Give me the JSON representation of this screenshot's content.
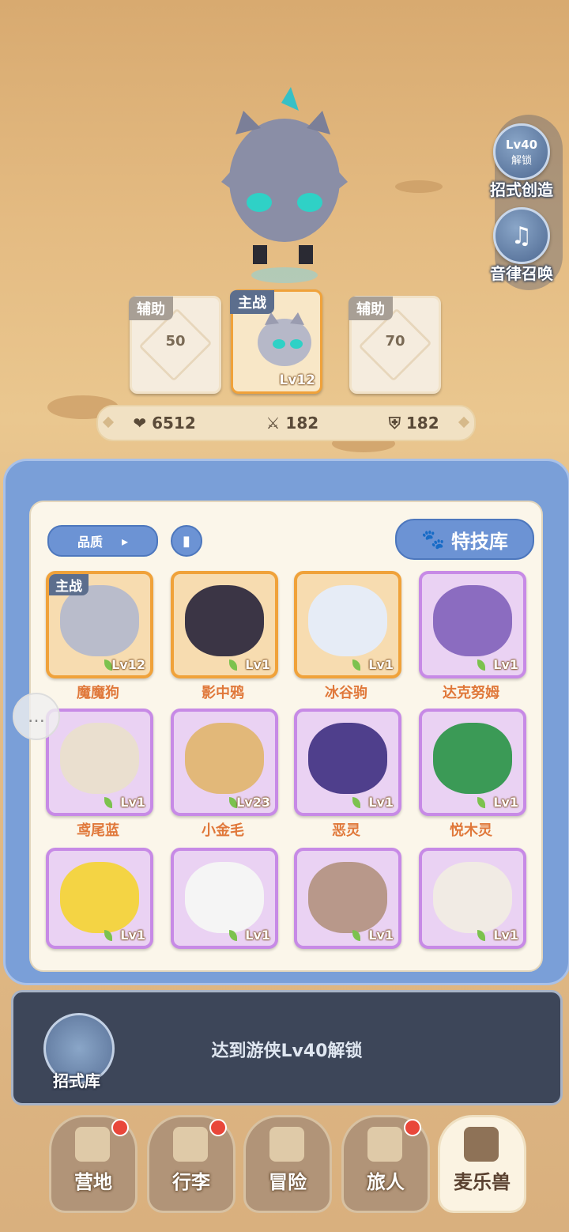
{
  "side_buttons": {
    "skill_create": {
      "badge_top": "Lv40",
      "badge_bottom": "解锁",
      "label": "招式创造"
    },
    "music_summon": {
      "label": "音律召唤"
    }
  },
  "team": {
    "left": {
      "tag": "辅助",
      "value": "50"
    },
    "main": {
      "tag": "主战",
      "level": "Lv12"
    },
    "right": {
      "tag": "辅助",
      "value": "70"
    }
  },
  "stats": {
    "hp": "6512",
    "attack": "182",
    "defense": "182"
  },
  "panel": {
    "filter_label": "品质",
    "skill_library_label": "特技库",
    "pets": [
      {
        "name": "魔魔狗",
        "level": "Lv12",
        "tag": "主战",
        "rarity": "orange",
        "color": "#b9bccb"
      },
      {
        "name": "影中鸦",
        "level": "Lv1",
        "rarity": "orange",
        "color": "#3b3545"
      },
      {
        "name": "冰谷驹",
        "level": "Lv1",
        "rarity": "orange",
        "color": "#e6ecf6"
      },
      {
        "name": "达克努姆",
        "level": "Lv1",
        "rarity": "purple",
        "color": "#8b6cc0"
      },
      {
        "name": "鸢尾蓝",
        "level": "Lv1",
        "rarity": "purple",
        "color": "#eadfcf"
      },
      {
        "name": "小金毛",
        "level": "Lv23",
        "rarity": "purple",
        "color": "#e2b879"
      },
      {
        "name": "恶灵",
        "level": "Lv1",
        "rarity": "purple",
        "color": "#4f3f8c"
      },
      {
        "name": "悦木灵",
        "level": "Lv1",
        "rarity": "purple",
        "color": "#3b9a56"
      },
      {
        "name": "",
        "level": "Lv1",
        "rarity": "purple",
        "color": "#f4d444"
      },
      {
        "name": "",
        "level": "Lv1",
        "rarity": "purple",
        "color": "#f5f5f5"
      },
      {
        "name": "",
        "level": "Lv1",
        "rarity": "purple",
        "color": "#b8988a"
      },
      {
        "name": "",
        "level": "Lv1",
        "rarity": "purple",
        "color": "#f1ebe4"
      }
    ]
  },
  "lock": {
    "label": "招式库",
    "message": "达到游侠Lv40解锁"
  },
  "nav": [
    {
      "label": "营地",
      "dot": true
    },
    {
      "label": "行李",
      "dot": true
    },
    {
      "label": "冒险",
      "dot": false
    },
    {
      "label": "旅人",
      "dot": true
    },
    {
      "label": "麦乐兽",
      "dot": false
    }
  ]
}
